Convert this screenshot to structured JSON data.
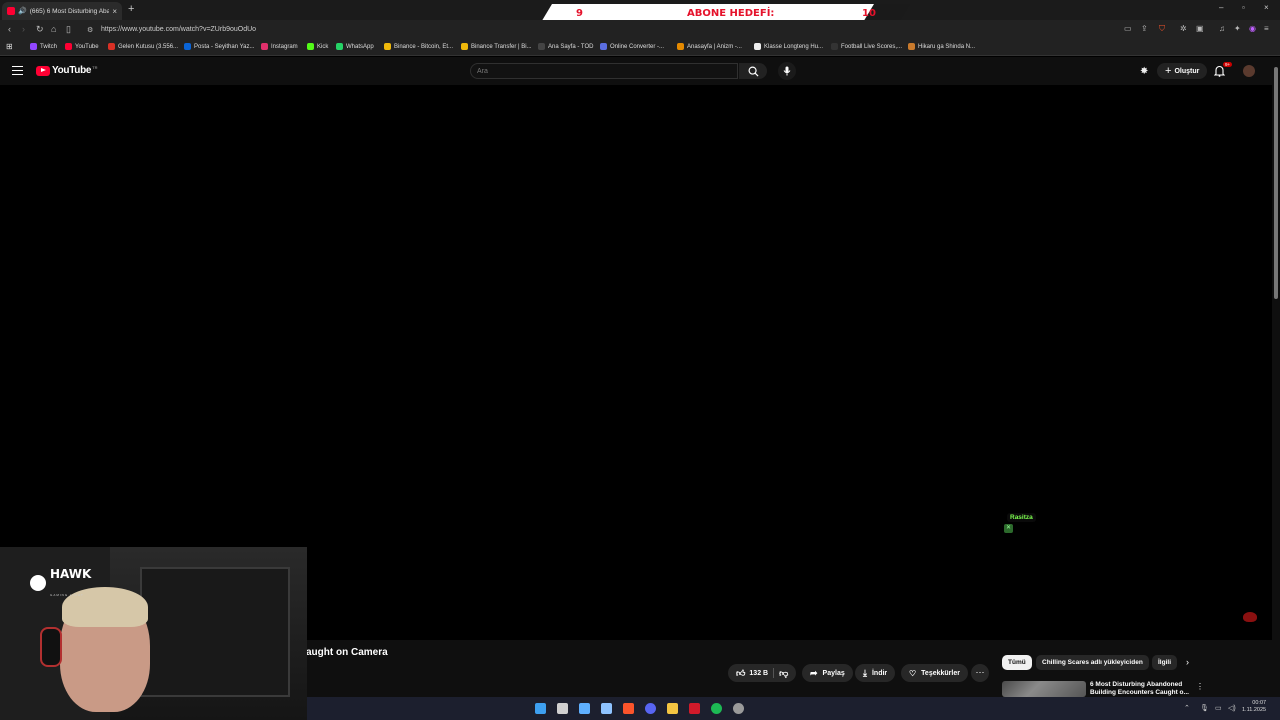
{
  "browser": {
    "tab": {
      "title": "(665) 6 Most Disturbing Aband",
      "close": "×"
    },
    "new_tab": "+",
    "window_controls": [
      "–",
      "▫",
      "×"
    ],
    "url": "https://www.youtube.com/watch?v=ZUrb9ouOdUo"
  },
  "overlay_goal": {
    "current": "9",
    "label": "ABONE HEDEFİ:",
    "target": "10"
  },
  "bookmarks": [
    {
      "label": "Twitch",
      "color": "#9146ff"
    },
    {
      "label": "YouTube",
      "color": "#ff0033"
    },
    {
      "label": "Gelen Kutusu (3.556...",
      "color": "#d93025"
    },
    {
      "label": "Posta - Seyithan Yaz...",
      "color": "#0a64d6"
    },
    {
      "label": "Instagram",
      "color": "#e1306c"
    },
    {
      "label": "Kick",
      "color": "#53fc18"
    },
    {
      "label": "WhatsApp",
      "color": "#25d366"
    },
    {
      "label": "Binance - Bitcoin, Et...",
      "color": "#f0b90b"
    },
    {
      "label": "Binance Transfer | Bi...",
      "color": "#f0b90b"
    },
    {
      "label": "Ana Sayfa - TOD",
      "color": "#444444"
    },
    {
      "label": "Online Converter -...",
      "color": "#5b6ee1"
    },
    {
      "label": "Anasayfa | Anizm -...",
      "color": "#e58a00"
    },
    {
      "label": "Klasse Longteng Hu...",
      "color": "#eeeeee"
    },
    {
      "label": "Football Live Scores,...",
      "color": "#333333"
    },
    {
      "label": "Hikaru ga Shinda N...",
      "color": "#c97a2c"
    }
  ],
  "youtube": {
    "logo": "YouTube",
    "country": "TR",
    "search_placeholder": "Ara",
    "create_label": "Oluştur",
    "notif_badge": "9+"
  },
  "overlay": {
    "chat_user": "Rasitza"
  },
  "video": {
    "title_visible": "aught on Camera",
    "likes": "132 B",
    "actions": {
      "share": "Paylaş",
      "download": "İndir",
      "thanks": "Teşekkürler",
      "more": "⋯"
    }
  },
  "chips": [
    {
      "label": "Tümü",
      "active": true
    },
    {
      "label": "Chilling Scares adlı yükleyiciden",
      "active": false
    },
    {
      "label": "İlgili",
      "active": false
    }
  ],
  "recommended": {
    "title": "6 Most Disturbing Abandoned Building Encounters Caught o...",
    "menu": "⋮"
  },
  "webcam": {
    "brand": "HAWK",
    "brand_sub": "GAMING LIGHT"
  },
  "taskbar": {
    "icons": [
      {
        "name": "windows-start-icon",
        "color": "#3ea0f0"
      },
      {
        "name": "search-icon",
        "color": "#d0d0d0"
      },
      {
        "name": "copilot-icon",
        "color": "#5fb0ff"
      },
      {
        "name": "arrow-icon",
        "color": "#8fc3ff"
      },
      {
        "name": "brave-icon",
        "color": "#fb542b"
      },
      {
        "name": "discord-icon",
        "color": "#5865f2"
      },
      {
        "name": "folder-icon",
        "color": "#f4c542"
      },
      {
        "name": "red-app-icon",
        "color": "#d11a2a"
      },
      {
        "name": "spotify-icon",
        "color": "#1db954"
      },
      {
        "name": "obs-icon",
        "color": "#9a9a9a"
      }
    ],
    "time": "00:07",
    "date": "1.11.2025"
  }
}
